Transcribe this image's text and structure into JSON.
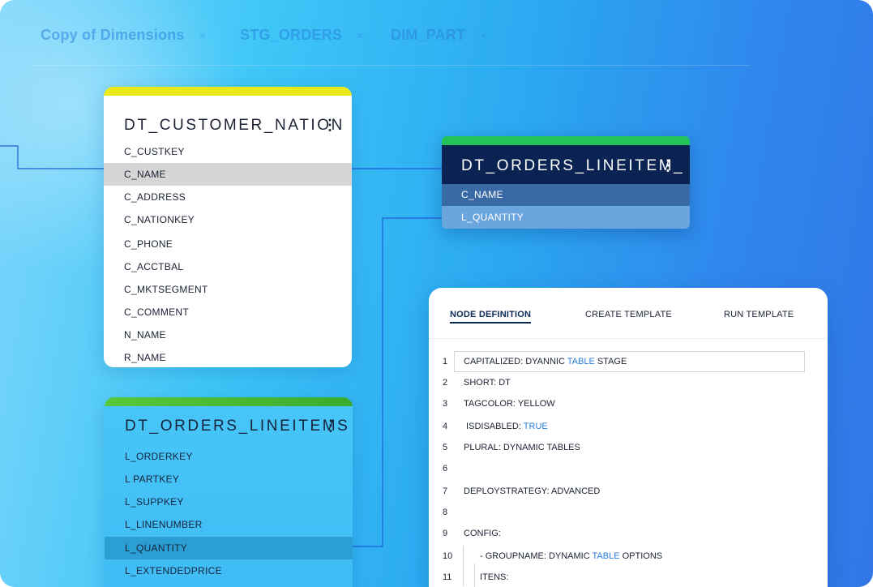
{
  "tabs": [
    {
      "label": "Copy of Dimensions",
      "close": "×"
    },
    {
      "label": "STG_ORDERS",
      "close": "×"
    },
    {
      "label": "DIM_PART",
      "close": "×"
    }
  ],
  "nodes": {
    "customer_nation": {
      "title": "DT_CUSTOMER_NATION",
      "menu_icon": "kebab-menu-icon",
      "accent": "#ece91b",
      "columns": [
        "C_CUSTKEY",
        "C_NAME",
        "C_ADDRESS",
        "C_NATIONKEY",
        "C_PHONE",
        "C_ACCTBAL",
        "C_MKTSEGMENT",
        "C_COMMENT",
        "N_NAME",
        "R_NAME"
      ],
      "selected": "C_NAME"
    },
    "orders_lineitems": {
      "title": "DT_ORDERS_LINEITEMS",
      "menu_icon": "kebab-menu-icon",
      "accent": "#58c93a",
      "columns": [
        "L_ORDERKEY",
        "L PARTKEY",
        "L_SUPPKEY",
        "L_LINENUMBER",
        "L_QUANTITY",
        "L_EXTENDEDPRICE"
      ],
      "selected": "L_QUANTITY"
    },
    "orders_lineitem_target": {
      "title": "DT_ORDERS_LINEITEM_",
      "menu_icon": "kebab-menu-icon",
      "accent": "#22c35a",
      "columns": [
        "C_NAME",
        "L_QUANTITY"
      ]
    }
  },
  "panel": {
    "tabs": [
      "NODE DEFINITION",
      "CREATE TEMPLATE",
      "RUN TEMPLATE"
    ],
    "active_tab": "NODE DEFINITION",
    "lines": [
      {
        "n": "1",
        "pre": "CAPITALIZED: DYANNIC ",
        "kw": "TABLE",
        "post": " STAGE"
      },
      {
        "n": "2",
        "pre": "SHORT: DT",
        "kw": "",
        "post": ""
      },
      {
        "n": "3",
        "pre": "TAGCOLOR: YELLOW",
        "kw": "",
        "post": ""
      },
      {
        "n": "4",
        "pre": " ISDISABLED: ",
        "kw": "TRUE",
        "post": ""
      },
      {
        "n": "5",
        "pre": "PLURAL: DYNAMIC TABLES",
        "kw": "",
        "post": ""
      },
      {
        "n": "6",
        "pre": "",
        "kw": "",
        "post": ""
      },
      {
        "n": "7",
        "pre": "DEPLOYSTRATEGY: ADVANCED",
        "kw": "",
        "post": ""
      },
      {
        "n": "8",
        "pre": "",
        "kw": "",
        "post": ""
      },
      {
        "n": "9",
        "pre": "CONFIG:",
        "kw": "",
        "post": ""
      },
      {
        "n": "10",
        "pre": "- GROUPNAME: DYNAMIC ",
        "kw": "TABLE",
        "post": " OPTIONS"
      },
      {
        "n": "11",
        "pre": "ITENS:",
        "kw": "",
        "post": ""
      }
    ],
    "keyword_color": "#2a7de1"
  }
}
